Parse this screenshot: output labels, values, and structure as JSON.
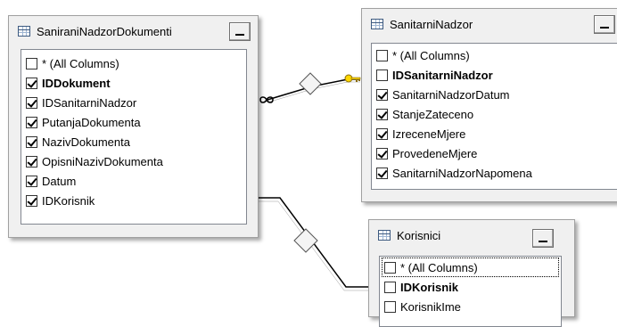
{
  "tables": {
    "dokumenti": {
      "title": "SaniraniNadzorDokumenti",
      "columns": [
        {
          "label": "* (All Columns)",
          "checked": false,
          "key": false
        },
        {
          "label": "IDDokument",
          "checked": true,
          "key": true
        },
        {
          "label": "IDSanitarniNadzor",
          "checked": true,
          "key": false
        },
        {
          "label": "PutanjaDokumenta",
          "checked": true,
          "key": false
        },
        {
          "label": "NazivDokumenta",
          "checked": true,
          "key": false
        },
        {
          "label": "OpisniNazivDokumenta",
          "checked": true,
          "key": false
        },
        {
          "label": "Datum",
          "checked": true,
          "key": false
        },
        {
          "label": "IDKorisnik",
          "checked": true,
          "key": false
        }
      ]
    },
    "nadzor": {
      "title": "SanitarniNadzor",
      "columns": [
        {
          "label": "* (All Columns)",
          "checked": false,
          "key": false
        },
        {
          "label": "IDSanitarniNadzor",
          "checked": false,
          "key": true
        },
        {
          "label": "SanitarniNadzorDatum",
          "checked": true,
          "key": false
        },
        {
          "label": "StanjeZateceno",
          "checked": true,
          "key": false
        },
        {
          "label": "IzreceneMjere",
          "checked": true,
          "key": false
        },
        {
          "label": "ProvedeneMjere",
          "checked": true,
          "key": false
        },
        {
          "label": "SanitarniNadzorNapomena",
          "checked": true,
          "key": false
        }
      ]
    },
    "korisnici": {
      "title": "Korisnici",
      "columns": [
        {
          "label": "* (All Columns)",
          "checked": false,
          "key": false,
          "focused": true
        },
        {
          "label": "IDKorisnik",
          "checked": false,
          "key": true
        },
        {
          "label": "KorisnikIme",
          "checked": false,
          "key": false
        }
      ]
    }
  },
  "icons": {
    "table": "table-grid-icon",
    "key": "key-icon",
    "infinity": "infinity-icon",
    "minimize": "minimize-icon"
  },
  "colors": {
    "key_fill": "#ffd700",
    "icon_border": "#3d5a80",
    "frame": "#f0f0f0"
  }
}
